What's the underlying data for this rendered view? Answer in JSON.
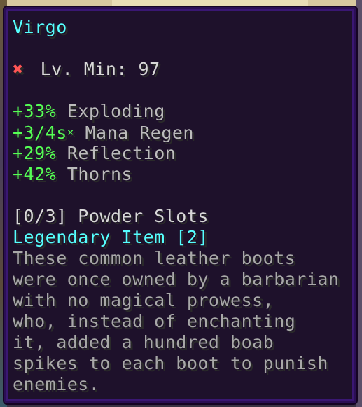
{
  "item": {
    "name": "Virgo",
    "requirement": {
      "icon": "x-icon",
      "icon_glyph": "✖",
      "text": "Lv. Min: 97"
    },
    "stats": [
      {
        "value": "+33%",
        "label": "Exploding"
      },
      {
        "value": "+3/4s",
        "label": "Mana Regen"
      },
      {
        "value": "+29%",
        "label": "Reflection"
      },
      {
        "value": "+42%",
        "label": "Thorns"
      }
    ],
    "mana_regen_marker": "×",
    "powder_slots": "[0/3] Powder Slots",
    "tier": "Legendary Item [2]",
    "lore": [
      "These common leather boots",
      "were once owned by a barbarian",
      "with no magical prowess,",
      "who, instead of enchanting",
      "it, added a hundred boab",
      "spikes to each boot to punish",
      "enemies."
    ]
  },
  "colors": {
    "name": "#55ffff",
    "stat_value": "#55ff55",
    "tier": "#55ffff",
    "lore": "#a8a8a8",
    "requirement_fail": "#ff5555",
    "tooltip_border": "#2b0f54"
  }
}
